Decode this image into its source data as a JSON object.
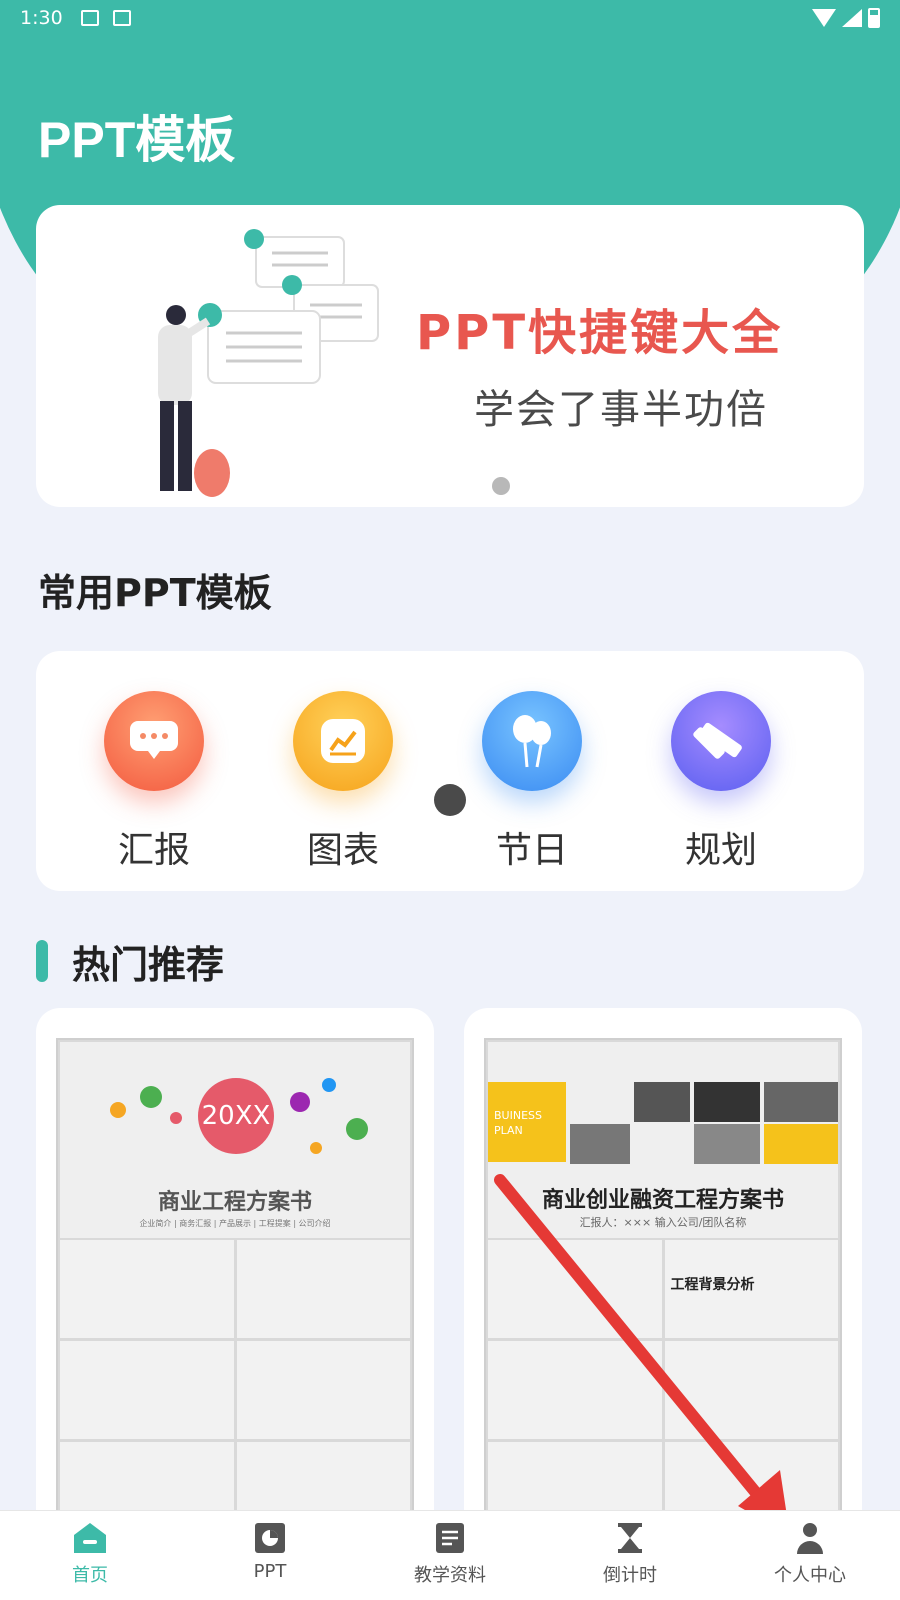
{
  "status_bar": {
    "time": "1:30"
  },
  "app": {
    "title": "PPT模板"
  },
  "banner": {
    "title": "PPT快捷键大全",
    "subtitle": "学会了事半功倍"
  },
  "common_section": {
    "title": "常用PPT模板",
    "categories": [
      {
        "label": "汇报",
        "icon": "chat-bubble-icon",
        "color": "#f35a3f"
      },
      {
        "label": "图表",
        "icon": "line-chart-icon",
        "color": "#f6a21a"
      },
      {
        "label": "节日",
        "icon": "balloons-icon",
        "color": "#3a8bf2"
      },
      {
        "label": "规划",
        "icon": "ruler-pencil-icon",
        "color": "#5b5ff0"
      }
    ]
  },
  "hot_section": {
    "title": "热门推荐",
    "templates": [
      {
        "badge": "20XX",
        "title": "商业工程方案书",
        "subtitle": "企业简介 | 商务汇报 | 产品展示 | 工程提案 | 公司介绍"
      },
      {
        "corner": "BUINESS PLAN",
        "title": "商业创业融资工程方案书",
        "subtitle": "汇报人：×××    输入公司/团队名称",
        "section": "工程背景分析"
      }
    ]
  },
  "tabbar": {
    "items": [
      {
        "label": "首页",
        "icon": "home-icon",
        "active": true
      },
      {
        "label": "PPT",
        "icon": "ppt-icon",
        "active": false
      },
      {
        "label": "教学资料",
        "icon": "document-icon",
        "active": false
      },
      {
        "label": "倒计时",
        "icon": "hourglass-icon",
        "active": false
      },
      {
        "label": "个人中心",
        "icon": "person-icon",
        "active": false
      }
    ]
  },
  "colors": {
    "accent": "#3dbaa8",
    "background": "#eff2fa",
    "banner_title": "#e8574f"
  }
}
